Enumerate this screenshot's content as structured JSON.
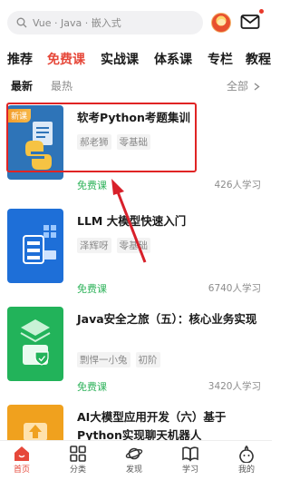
{
  "search": {
    "placeholder": "Vue · Java · 嵌入式"
  },
  "categories": [
    {
      "label": "推荐",
      "active": false
    },
    {
      "label": "免费课",
      "active": true
    },
    {
      "label": "实战课",
      "active": false
    },
    {
      "label": "体系课",
      "active": false
    },
    {
      "label": "专栏",
      "active": false
    },
    {
      "label": "教程",
      "active": false
    }
  ],
  "subtabs": {
    "active": "最新",
    "inactive": "最热",
    "all_label": "全部"
  },
  "courses": [
    {
      "badge": "新课",
      "title": "软考Python考题集训",
      "tags": [
        "郝老狮",
        "零基础"
      ],
      "price": "免费课",
      "learners": "426人学习",
      "thumb_color": "#2e74b8"
    },
    {
      "title": "LLM 大模型快速入门",
      "tags": [
        "泽辉呀",
        "零基础"
      ],
      "price": "免费课",
      "learners": "6740人学习",
      "thumb_color": "#1e6fd8"
    },
    {
      "title": "Java安全之旅（五）：核心业务实现",
      "tags": [
        "剽悍一小兔",
        "初阶"
      ],
      "price": "免费课",
      "learners": "3420人学习",
      "thumb_color": "#22b35a"
    },
    {
      "title": "AI大模型应用开发（六）基于Python实现聊天机器人",
      "tags": [],
      "price": "",
      "learners": "",
      "thumb_color": "#f0a11e"
    }
  ],
  "bottom_nav": [
    {
      "label": "首页",
      "icon": "home-icon",
      "active": true
    },
    {
      "label": "分类",
      "icon": "grid-icon",
      "active": false
    },
    {
      "label": "发现",
      "icon": "planet-icon",
      "active": false
    },
    {
      "label": "学习",
      "icon": "book-icon",
      "active": false
    },
    {
      "label": "我的",
      "icon": "smile-icon",
      "active": false
    }
  ],
  "colors": {
    "accent": "#e6483a",
    "free": "#2fb35b",
    "highlight": "#e02424"
  }
}
